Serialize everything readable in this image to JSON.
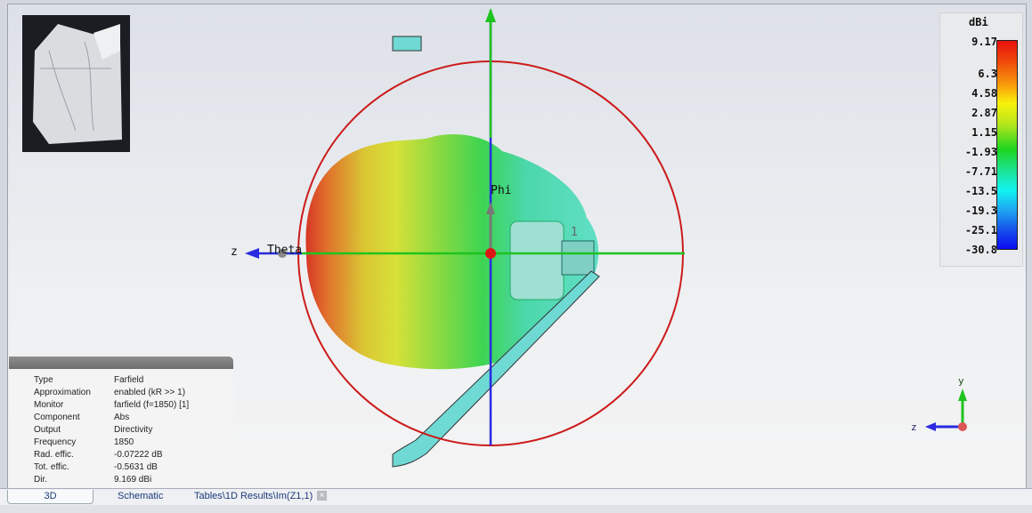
{
  "legend": {
    "unit": "dBi",
    "ticks": [
      "9.17",
      "6.3",
      "4.58",
      "2.87",
      "1.15",
      "-1.93",
      "-7.71",
      "-13.5",
      "-19.3",
      "-25.1",
      "-30.8"
    ]
  },
  "axes": {
    "phi": "Phi",
    "theta": "Theta",
    "z": "z",
    "port": "1",
    "mini_y": "y",
    "mini_z": "z"
  },
  "info": {
    "rows": [
      {
        "k": "Type",
        "v": "Farfield"
      },
      {
        "k": "Approximation",
        "v": "enabled (kR >> 1)"
      },
      {
        "k": "Monitor",
        "v": "farfield (f=1850) [1]"
      },
      {
        "k": "Component",
        "v": "Abs"
      },
      {
        "k": "Output",
        "v": "Directivity"
      },
      {
        "k": "Frequency",
        "v": "1850"
      },
      {
        "k": "Rad. effic.",
        "v": "-0.07222 dB"
      },
      {
        "k": "Tot. effic.",
        "v": "-0.5631 dB"
      },
      {
        "k": "Dir.",
        "v": "9.169 dBi"
      }
    ]
  },
  "tabs": [
    "3D",
    "Schematic",
    "Tables\\1D Results\\Im(Z1,1)"
  ],
  "tab_close": "×"
}
